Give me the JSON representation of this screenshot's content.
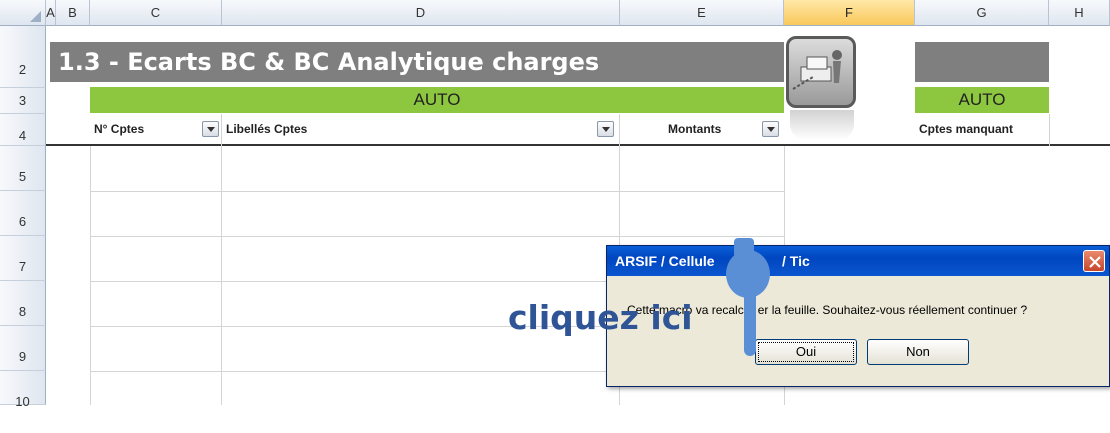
{
  "columns": [
    "A",
    "B",
    "C",
    "D",
    "E",
    "F",
    "G",
    "H"
  ],
  "rows": [
    "2",
    "3",
    "4",
    "5",
    "6",
    "7",
    "8",
    "9",
    "10"
  ],
  "sheet": {
    "title": "1.3 - Ecarts BC & BC Analytique charges",
    "auto_label": "AUTO",
    "auto_label_right": "AUTO",
    "headers": {
      "n_cptes": "N° Cptes",
      "libelles": "Libellés Cptes",
      "montants": "Montants",
      "manquant": "Cptes manquant"
    }
  },
  "dialog": {
    "title": "ARSIF / Cellule",
    "title_suffix": "/ Tic",
    "message": "Cette macro va recalc",
    "message_suffix": "er la feuille. Souhaitez-vous réellement continuer ?",
    "ok_label": "Oui",
    "no_label": "Non"
  },
  "overlay": {
    "hint_text": "cliquez ici",
    "accent_color": "#5a8fd6"
  },
  "colors": {
    "title_band": "#7f7f7f",
    "auto_band": "#8dc63f",
    "selected_column": "#f9c85c",
    "dialog_titlebar": "#0a5fd8"
  }
}
